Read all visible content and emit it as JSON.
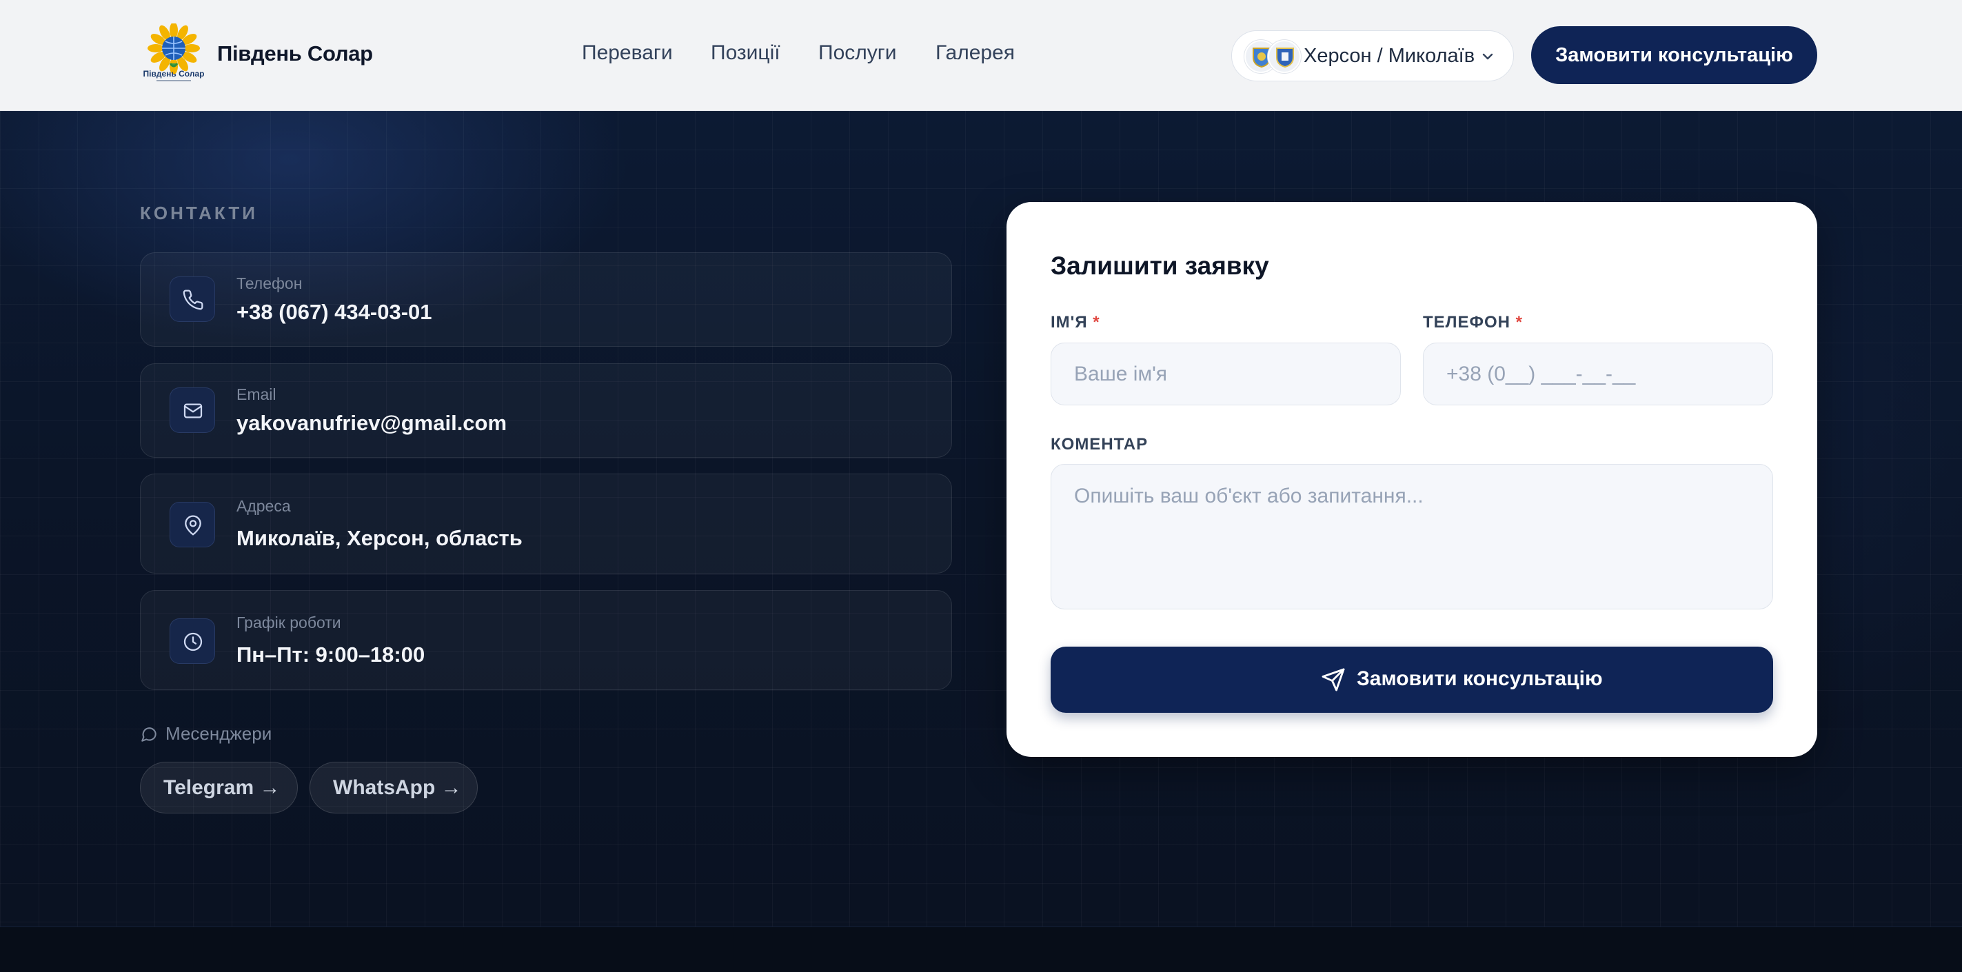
{
  "brand": {
    "name": "Південь Солар",
    "logo_caption": "Південь Солар"
  },
  "nav": {
    "items": [
      {
        "label": "Переваги"
      },
      {
        "label": "Позиції"
      },
      {
        "label": "Послуги"
      },
      {
        "label": "Галерея"
      }
    ]
  },
  "region": {
    "label": "Херсон / Миколаїв",
    "icon": "chevron-down-icon"
  },
  "header_cta": {
    "label": "Замовити консультацію"
  },
  "contacts": {
    "title": "КОНТАКТИ",
    "items": [
      {
        "icon": "phone-icon",
        "label": "Телефон",
        "value": "+38 (067) 434-03-01"
      },
      {
        "icon": "mail-icon",
        "label": "Email",
        "value": "yakovanufriev@gmail.com"
      },
      {
        "icon": "map-pin-icon",
        "label": "Адреса",
        "value": "Миколаїв, Херсон, область"
      },
      {
        "icon": "clock-icon",
        "label": "Графік роботи",
        "value": "Пн–Пт: 9:00–18:00"
      }
    ],
    "messengers": {
      "label": "Месенджери",
      "links": [
        {
          "label": "Telegram →"
        },
        {
          "label": "WhatsApp →"
        }
      ]
    }
  },
  "form": {
    "title": "Залишити заявку",
    "name": {
      "label": "ІМ'Я",
      "required_mark": "*",
      "placeholder": "Ваше ім'я"
    },
    "phone": {
      "label": "ТЕЛЕФОН",
      "required_mark": "*",
      "placeholder": "+38 (0__) ___-__-__"
    },
    "comment": {
      "label": "КОМЕНТАР",
      "placeholder": "Опишіть ваш об'єкт або запитання..."
    },
    "submit": {
      "label": "Замовити консультацію",
      "icon": "send-icon"
    }
  },
  "colors": {
    "accent": "#0f2456",
    "page_dark": "#0b1322",
    "header_bg": "#f2f3f5",
    "required": "#e0463f"
  }
}
